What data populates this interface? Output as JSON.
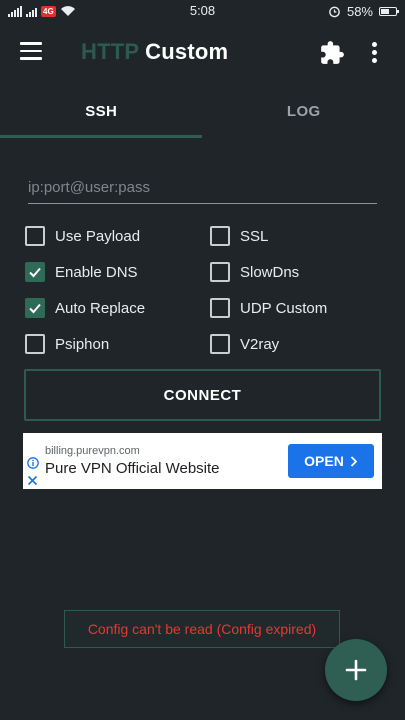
{
  "status_bar": {
    "time": "5:08",
    "battery_text": "58%",
    "battery_level": 0.58,
    "icons": [
      "signal-icon",
      "sim-badge-icon",
      "wifi-icon",
      "alarm-icon",
      "battery-icon"
    ]
  },
  "app_bar": {
    "title_part1": "HTTP",
    "title_part2": "Custom",
    "icons": [
      "menu-icon",
      "puzzle-icon",
      "more-vert-icon"
    ]
  },
  "tabs": [
    {
      "label": "SSH",
      "active": true
    },
    {
      "label": "LOG",
      "active": false
    }
  ],
  "server_input": {
    "placeholder": "ip:port@user:pass",
    "value": ""
  },
  "options": {
    "use_payload": {
      "label": "Use Payload",
      "checked": false
    },
    "ssl": {
      "label": "SSL",
      "checked": false
    },
    "enable_dns": {
      "label": "Enable DNS",
      "checked": true
    },
    "slowdns": {
      "label": "SlowDns",
      "checked": false
    },
    "auto_replace": {
      "label": "Auto Replace",
      "checked": true
    },
    "udp_custom": {
      "label": "UDP Custom",
      "checked": false
    },
    "psiphon": {
      "label": "Psiphon",
      "checked": false
    },
    "v2ray": {
      "label": "V2ray",
      "checked": false
    }
  },
  "connect_button": {
    "label": "CONNECT"
  },
  "ad": {
    "url": "billing.purevpn.com",
    "title": "Pure VPN Official Website",
    "button_label": "OPEN"
  },
  "toast": {
    "message": "Config can't be read (Config expired)"
  },
  "colors": {
    "background": "#1f2529",
    "accent": "#2f6a57",
    "title_accent": "#2c5a4d",
    "error": "#e53935",
    "ad_button": "#1a73e8"
  }
}
